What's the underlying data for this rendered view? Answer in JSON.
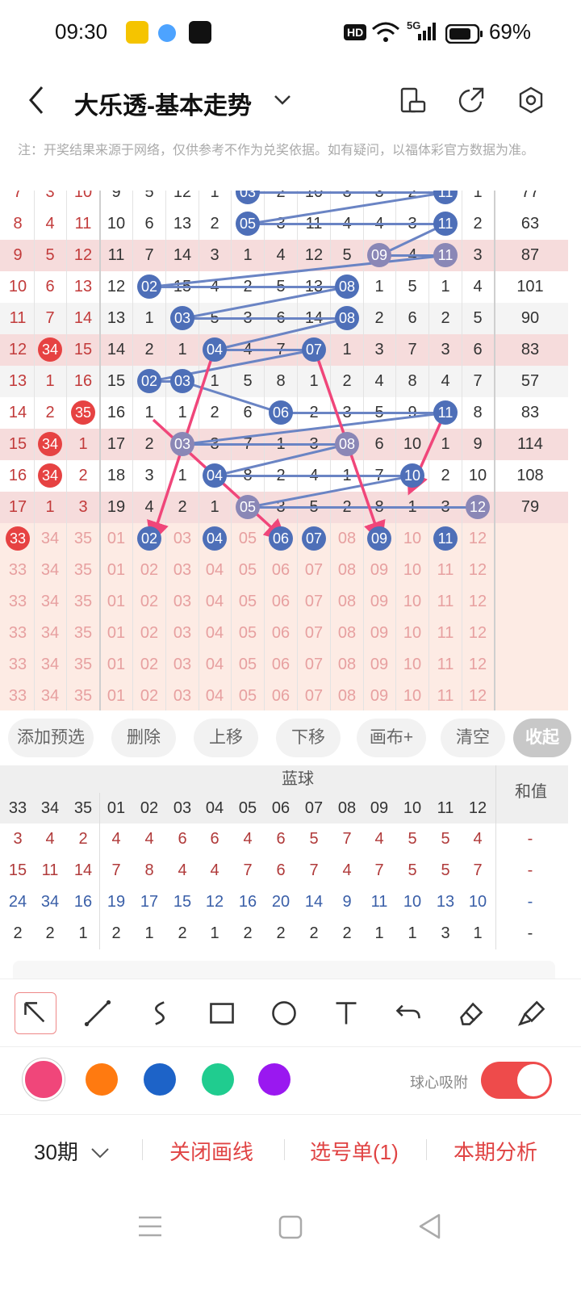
{
  "status_bar": {
    "time": "09:30",
    "hd": "HD",
    "network": "5G",
    "battery": "69%"
  },
  "header": {
    "title": "大乐透-基本走势"
  },
  "note": "注：开奖结果来源于网络，仅供参考不作为兑奖依据。如有疑问，以福体彩官方数据为准。",
  "chart_rows": [
    {
      "front": [
        "7",
        "3",
        "10"
      ],
      "blue": [
        "9",
        "5",
        "12",
        "1",
        "03",
        "2",
        "10",
        "3",
        "3",
        "2",
        "11",
        "1"
      ],
      "sum": "77",
      "bg": "plain",
      "balls": [
        4,
        10
      ]
    },
    {
      "front": [
        "8",
        "4",
        "11"
      ],
      "blue": [
        "10",
        "6",
        "13",
        "2",
        "05",
        "3",
        "11",
        "4",
        "4",
        "3",
        "11",
        "2"
      ],
      "sum": "63",
      "bg": "plain",
      "balls": [
        4,
        10
      ]
    },
    {
      "front": [
        "9",
        "5",
        "12"
      ],
      "blue": [
        "11",
        "7",
        "14",
        "3",
        "1",
        "4",
        "12",
        "5",
        "09",
        "4",
        "11",
        "3"
      ],
      "sum": "87",
      "bg": "hl",
      "balls": [
        8,
        10
      ],
      "purple": true
    },
    {
      "front": [
        "10",
        "6",
        "13"
      ],
      "blue": [
        "12",
        "02",
        "15",
        "4",
        "2",
        "5",
        "13",
        "08",
        "1",
        "5",
        "1",
        "4"
      ],
      "sum": "101",
      "bg": "plain",
      "balls": [
        1,
        7
      ]
    },
    {
      "front": [
        "11",
        "7",
        "14"
      ],
      "blue": [
        "13",
        "1",
        "03",
        "5",
        "3",
        "6",
        "14",
        "08",
        "2",
        "6",
        "2",
        "5"
      ],
      "sum": "90",
      "bg": "alt",
      "balls": [
        2,
        7
      ]
    },
    {
      "front": [
        "12",
        "34",
        "15"
      ],
      "blue": [
        "14",
        "2",
        "1",
        "04",
        "4",
        "7",
        "07",
        "1",
        "3",
        "7",
        "3",
        "6"
      ],
      "sum": "83",
      "bg": "hl",
      "balls": [
        3,
        6
      ],
      "redball": 1
    },
    {
      "front": [
        "13",
        "1",
        "16"
      ],
      "blue": [
        "15",
        "02",
        "03",
        "1",
        "5",
        "8",
        "1",
        "2",
        "4",
        "8",
        "4",
        "7"
      ],
      "sum": "57",
      "bg": "alt",
      "balls": [
        1,
        2
      ]
    },
    {
      "front": [
        "14",
        "2",
        "35"
      ],
      "blue": [
        "16",
        "1",
        "1",
        "2",
        "6",
        "06",
        "2",
        "3",
        "5",
        "9",
        "11",
        "8"
      ],
      "sum": "83",
      "bg": "plain",
      "balls": [
        5,
        10
      ],
      "redball": 2
    },
    {
      "front": [
        "15",
        "34",
        "1"
      ],
      "blue": [
        "17",
        "2",
        "03",
        "3",
        "7",
        "1",
        "3",
        "08",
        "6",
        "10",
        "1",
        "9"
      ],
      "sum": "114",
      "bg": "hl",
      "balls": [
        2,
        7
      ],
      "redball": 1,
      "purple": true
    },
    {
      "front": [
        "16",
        "34",
        "2"
      ],
      "blue": [
        "18",
        "3",
        "1",
        "04",
        "8",
        "2",
        "4",
        "1",
        "7",
        "10",
        "2",
        "10"
      ],
      "sum": "108",
      "bg": "plain",
      "balls": [
        3,
        9
      ],
      "redball": 1
    },
    {
      "front": [
        "17",
        "1",
        "3"
      ],
      "blue": [
        "19",
        "4",
        "2",
        "1",
        "05",
        "3",
        "5",
        "2",
        "8",
        "1",
        "3",
        "12"
      ],
      "sum": "79",
      "bg": "hl",
      "balls": [
        4,
        11
      ],
      "purple": true
    }
  ],
  "selection_row": {
    "front": [
      "33",
      "34",
      "35"
    ],
    "blue": [
      "01",
      "02",
      "03",
      "04",
      "05",
      "06",
      "07",
      "08",
      "09",
      "10",
      "11",
      "12"
    ],
    "selected_front": [
      0
    ],
    "selected_blue": [
      1,
      3,
      5,
      6,
      8,
      10
    ]
  },
  "empty_rows": {
    "front": [
      "33",
      "34",
      "35"
    ],
    "blue": [
      "01",
      "02",
      "03",
      "04",
      "05",
      "06",
      "07",
      "08",
      "09",
      "10",
      "11",
      "12"
    ],
    "count": 5
  },
  "actions": [
    "添加预选",
    "删除",
    "上移",
    "下移",
    "画布+",
    "清空",
    "收起"
  ],
  "stats": {
    "group_label": "蓝球",
    "sum_label": "和值",
    "columns": [
      "33",
      "34",
      "35",
      "01",
      "02",
      "03",
      "04",
      "05",
      "06",
      "07",
      "08",
      "09",
      "10",
      "11",
      "12"
    ],
    "rows": [
      {
        "values": [
          "3",
          "4",
          "2",
          "4",
          "4",
          "6",
          "6",
          "4",
          "6",
          "5",
          "7",
          "4",
          "5",
          "5",
          "4"
        ],
        "sum": "-",
        "color": "#b03a3a"
      },
      {
        "values": [
          "15",
          "11",
          "14",
          "7",
          "8",
          "4",
          "4",
          "7",
          "6",
          "7",
          "4",
          "7",
          "5",
          "5",
          "7"
        ],
        "sum": "-",
        "color": "#b03a3a"
      },
      {
        "values": [
          "24",
          "34",
          "16",
          "19",
          "17",
          "15",
          "12",
          "16",
          "20",
          "14",
          "9",
          "11",
          "10",
          "13",
          "10"
        ],
        "sum": "-",
        "color": "#3a5fa8"
      },
      {
        "values": [
          "2",
          "2",
          "1",
          "2",
          "1",
          "2",
          "1",
          "2",
          "2",
          "2",
          "2",
          "1",
          "1",
          "3",
          "1"
        ],
        "sum": "-",
        "color": "#333333"
      }
    ]
  },
  "tools": [
    "arrow-tool",
    "line-tool",
    "curve-tool",
    "rect-tool",
    "circle-tool",
    "text-tool",
    "undo-tool",
    "eraser-tool",
    "clear-brush-tool"
  ],
  "colors": [
    "#f0467a",
    "#ff7a10",
    "#1d63c8",
    "#20cc8f",
    "#9a18f0"
  ],
  "snap_label": "球心吸附",
  "bottom": {
    "period": "30期",
    "close_draw": "关闭画线",
    "pick_list": "选号单(1)",
    "analysis": "本期分析"
  }
}
